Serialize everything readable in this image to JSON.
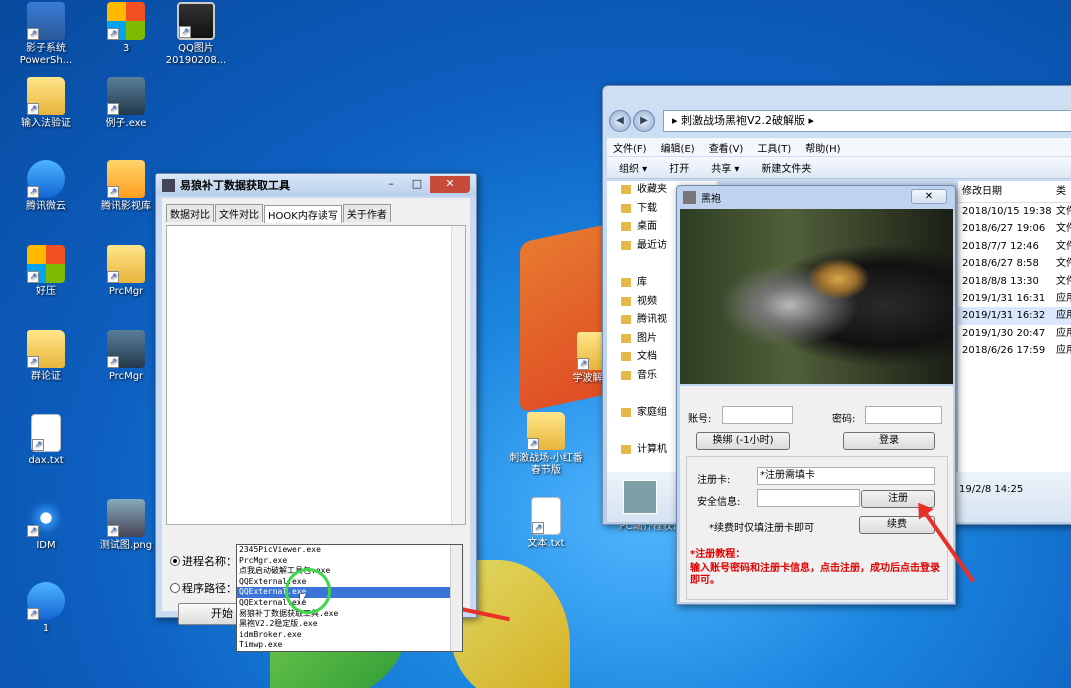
{
  "desktop": {
    "icons": [
      {
        "label": "影子系统 PowerSh...",
        "cls": "ps"
      },
      {
        "label": "3",
        "cls": "multi"
      },
      {
        "label": "QQ图片 20190208...",
        "cls": "qq"
      },
      {
        "label": "输入法验证",
        "cls": "folder"
      },
      {
        "label": "例子.exe",
        "cls": "dark"
      },
      {
        "label": "腾讯微云",
        "cls": "blue"
      },
      {
        "label": "腾讯影视库",
        "cls": "orange"
      },
      {
        "label": "好压",
        "cls": "multi"
      },
      {
        "label": "PrcMgr",
        "cls": "folder"
      },
      {
        "label": "群论证",
        "cls": "folder"
      },
      {
        "label": "PrcMgr",
        "cls": "dark"
      },
      {
        "label": "dax.txt",
        "cls": "file"
      },
      {
        "label": "IDM",
        "cls": "ie"
      },
      {
        "label": "测试图.png",
        "cls": "pic"
      },
      {
        "label": "1",
        "cls": "blue"
      },
      {
        "label": "刺激战场-小红番春节版",
        "cls": "folder"
      },
      {
        "label": "文本.txt",
        "cls": "file"
      },
      {
        "label": "学波解用C",
        "cls": "folder"
      },
      {
        "label": "PC端齐程牧设片",
        "cls": "green"
      }
    ]
  },
  "tool": {
    "title": "易狼补丁数据获取工具",
    "tabs": [
      "数据对比",
      "文件对比",
      "HOOK内存读写",
      "关于作者"
    ],
    "active_tab": 2,
    "process_label": "进程名称：",
    "path_label": "程序路径：",
    "start_label": "开始",
    "process_options": [
      "2345PicViewer.exe",
      "PrcMgr.exe",
      "点我启动破解工具包.exe",
      "QQExternal.exe",
      "QQExternal.exe",
      "QQExternal.exe",
      "易狼补丁数据获取工具.exe",
      "黑袍V2.2稳定版.exe",
      "idmBroker.exe",
      "Timwp.exe"
    ],
    "selected_option": 4
  },
  "explorer": {
    "path": "刺激战场黑袍V2.2破解版",
    "menu": [
      "文件(F)",
      "编辑(E)",
      "查看(V)",
      "工具(T)",
      "帮助(H)"
    ],
    "commands": [
      "组织 ▾",
      "打开",
      "共享 ▾",
      "新建文件夹"
    ],
    "sidebar": [
      "收藏夹",
      "下载",
      "桌面",
      "最近访",
      "",
      "库",
      "视频",
      "腾讯视",
      "图片",
      "文档",
      "音乐",
      "",
      "家庭组",
      "",
      "计算机"
    ],
    "date_header": "修改日期",
    "type_header": "类",
    "dates": [
      "2018/10/15 19:38",
      "2018/6/27 19:06",
      "2018/7/7 12:46",
      "2018/6/27 8:58",
      "2018/8/8 13:30",
      "2019/1/31 16:31",
      "2019/1/31 16:32",
      "2019/1/30 20:47",
      "2018/6/26 17:59"
    ],
    "types": [
      "文件",
      "文件",
      "文件",
      "文件",
      "文件",
      "应用",
      "应用",
      "应用",
      "应用"
    ],
    "selected_row": 6,
    "detail_date": "19/2/8 14:25"
  },
  "heipao": {
    "title": "黑袍",
    "account_label": "账号:",
    "password_label": "密码:",
    "unbind_label": "换绑 (-1小时)",
    "login_label": "登录",
    "card_label": "注册卡:",
    "card_value": "*注册需填卡",
    "security_label": "安全信息:",
    "register_label": "注册",
    "renew_hint": "*续费时仅填注册卡即可",
    "renew_label": "续费",
    "tutorial_title": "*注册教程：",
    "tutorial_text": "输入账号密码和注册卡信息，点击注册，成功后点击登录即可。"
  }
}
